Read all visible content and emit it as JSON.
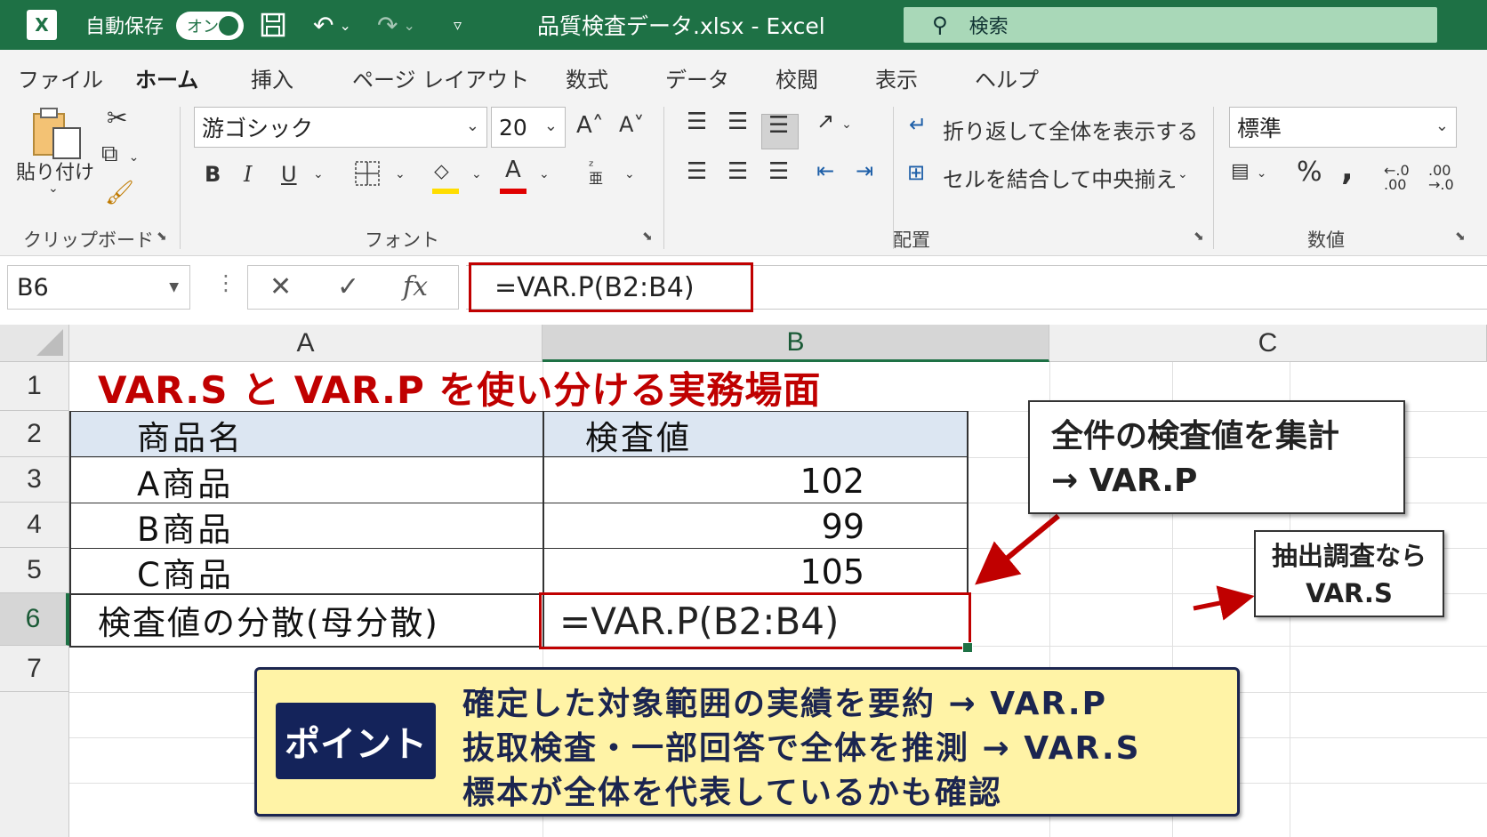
{
  "titlebar": {
    "logo": "X",
    "autosave_label": "自動保存",
    "autosave_state": "オン",
    "document_title": "品質検査データ.xlsx  -  Excel",
    "search_placeholder": "検索"
  },
  "tabs": [
    "ファイル",
    "ホーム",
    "挿入",
    "ページ レイアウト",
    "数式",
    "データ",
    "校閲",
    "表示",
    "ヘルプ"
  ],
  "active_tab": "ホーム",
  "ribbon": {
    "clipboard": {
      "paste_label": "貼り付け",
      "group_label": "クリップボード"
    },
    "font": {
      "font_name": "游ゴシック",
      "font_size": "20",
      "bold": "B",
      "italic": "I",
      "underline": "U",
      "font_color_glyph": "A",
      "grow": "A˄",
      "shrink": "A˅",
      "group_label": "フォント"
    },
    "alignment": {
      "wrap_text": "折り返して全体を表示する",
      "merge_center": "セルを結合して中央揃え",
      "group_label": "配置"
    },
    "number": {
      "format": "標準",
      "percent": "%",
      "comma": ",",
      "inc_decimal": "←.0 .00",
      "dec_decimal": ".00 →.0",
      "group_label": "数値"
    }
  },
  "formula_bar": {
    "name_box": "B6",
    "cancel": "✕",
    "enter": "✓",
    "fx": "fx",
    "formula": "=VAR.P(B2:B4)"
  },
  "sheet": {
    "columns": [
      "A",
      "B",
      "C"
    ],
    "selected_column": "B",
    "rows": [
      "1",
      "2",
      "3",
      "4",
      "5",
      "6",
      "7"
    ],
    "selected_row": "6",
    "title": "VAR.S と VAR.P を使い分ける実務場面",
    "header": {
      "a": "商品名",
      "b": "検査値"
    },
    "data": [
      {
        "a": "A商品",
        "b": "102"
      },
      {
        "a": "B商品",
        "b": "99"
      },
      {
        "a": "C商品",
        "b": "105"
      }
    ],
    "row6": {
      "a": "検査値の分散(母分散)",
      "b": "=VAR.P(B2:B4)"
    }
  },
  "callouts": {
    "population": {
      "line1": "全件の検査値を集計",
      "line2": "→ VAR.P"
    },
    "sample": {
      "line1": "抽出調査なら",
      "line2": "VAR.S"
    }
  },
  "point": {
    "badge": "ポイント",
    "lines": [
      "確定した対象範囲の実績を要約 → VAR.P",
      "抜取検査・一部回答で全体を推測 → VAR.S",
      "標本が全体を代表しているかも確認"
    ]
  },
  "colors": {
    "excel_green": "#1e7145",
    "highlight_red": "#c00000",
    "point_bg": "#fff3a6",
    "point_navy": "#14235a",
    "header_fill": "#dce6f2"
  }
}
